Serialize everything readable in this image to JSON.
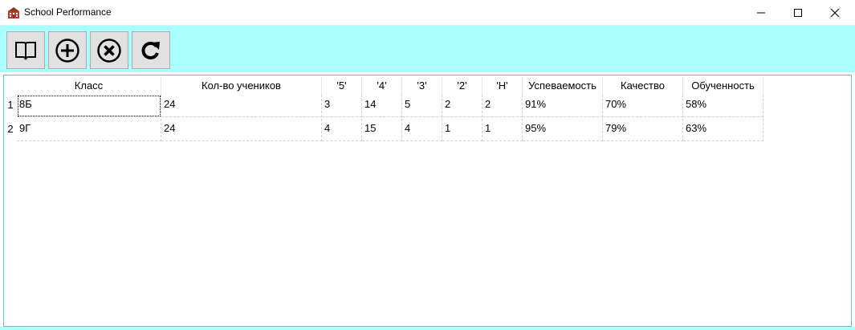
{
  "window": {
    "title": "School Performance",
    "icons": {
      "app": "school-building-icon",
      "minimize": "minimize-icon",
      "maximize": "maximize-icon",
      "close": "close-icon"
    }
  },
  "toolbar": {
    "buttons": [
      {
        "name": "open-book-button",
        "icon": "open-book-icon"
      },
      {
        "name": "add-button",
        "icon": "plus-circle-icon"
      },
      {
        "name": "delete-button",
        "icon": "x-circle-icon"
      },
      {
        "name": "refresh-button",
        "icon": "refresh-icon"
      }
    ]
  },
  "table": {
    "columns": [
      "Класс",
      "Кол-во учеников",
      "'5'",
      "'4'",
      "'3'",
      "'2'",
      "'Н'",
      "Успеваемость",
      "Качество",
      "Обученность"
    ],
    "rows": [
      {
        "num": "1",
        "cells": [
          "8Б",
          "24",
          "3",
          "14",
          "5",
          "2",
          "2",
          "91%",
          "70%",
          "58%"
        ]
      },
      {
        "num": "2",
        "cells": [
          "9Г",
          "24",
          "4",
          "15",
          "4",
          "1",
          "1",
          "95%",
          "79%",
          "63%"
        ]
      }
    ]
  },
  "colors": {
    "toolbar": "#aaffff",
    "button_face": "#e1e1e1"
  }
}
